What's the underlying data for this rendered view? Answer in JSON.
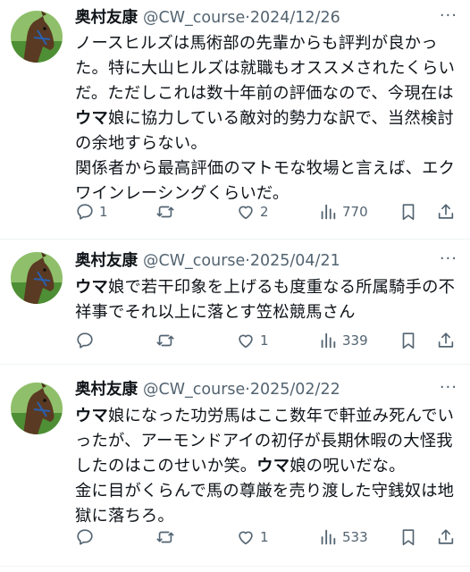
{
  "tweets": [
    {
      "name": "奥村友康",
      "handle": "@CW_course",
      "sep": "·",
      "date": "2024/12/26",
      "more": "···",
      "paragraphs": [
        [
          {
            "t": "ノースヒルズは馬術部の先輩からも評判が良かった。特に大山ヒルズは就職もオススメされたくらいだ。ただしこれは数十年前の評価なので、今現在は",
            "b": false
          },
          {
            "t": "ウマ",
            "b": true
          },
          {
            "t": "娘に協力している敵対的勢力な訳で、当然検討の余地すらない。",
            "b": false
          }
        ],
        [
          {
            "t": "関係者から最高評価のマトモな牧場と言えば、エクワインレーシングくらいだ。",
            "b": false
          }
        ]
      ],
      "replies": "1",
      "retweets": "",
      "likes": "2",
      "views": "770"
    },
    {
      "name": "奥村友康",
      "handle": "@CW_course",
      "sep": "·",
      "date": "2025/04/21",
      "more": "···",
      "paragraphs": [
        [
          {
            "t": "ウマ",
            "b": true
          },
          {
            "t": "娘で若干印象を上げるも度重なる所属騎手の不祥事でそれ以上に落とす笠松競馬さん",
            "b": false
          }
        ]
      ],
      "replies": "",
      "retweets": "",
      "likes": "1",
      "views": "339"
    },
    {
      "name": "奥村友康",
      "handle": "@CW_course",
      "sep": "·",
      "date": "2025/02/22",
      "more": "···",
      "paragraphs": [
        [
          {
            "t": "ウマ",
            "b": true
          },
          {
            "t": "娘になった功労馬はここ数年で軒並み死んでいったが、アーモンドアイの初仔が長期休暇の大怪我したのはこのせいか笑。",
            "b": false
          },
          {
            "t": "ウマ",
            "b": true
          },
          {
            "t": "娘の呪いだな。",
            "b": false
          }
        ],
        [
          {
            "t": "金に目がくらんで馬の尊厳を売り渡した守銭奴は地獄に落ちろ。",
            "b": false
          }
        ]
      ],
      "replies": "",
      "retweets": "",
      "likes": "1",
      "views": "533"
    }
  ],
  "icons": {
    "reply": "reply-icon",
    "retweet": "retweet-icon",
    "like": "heart-icon",
    "views": "views-icon",
    "bookmark": "bookmark-icon",
    "share": "share-icon"
  },
  "colors": {
    "text": "#0f1419",
    "secondary": "#536471",
    "divider": "#eff3f4"
  }
}
